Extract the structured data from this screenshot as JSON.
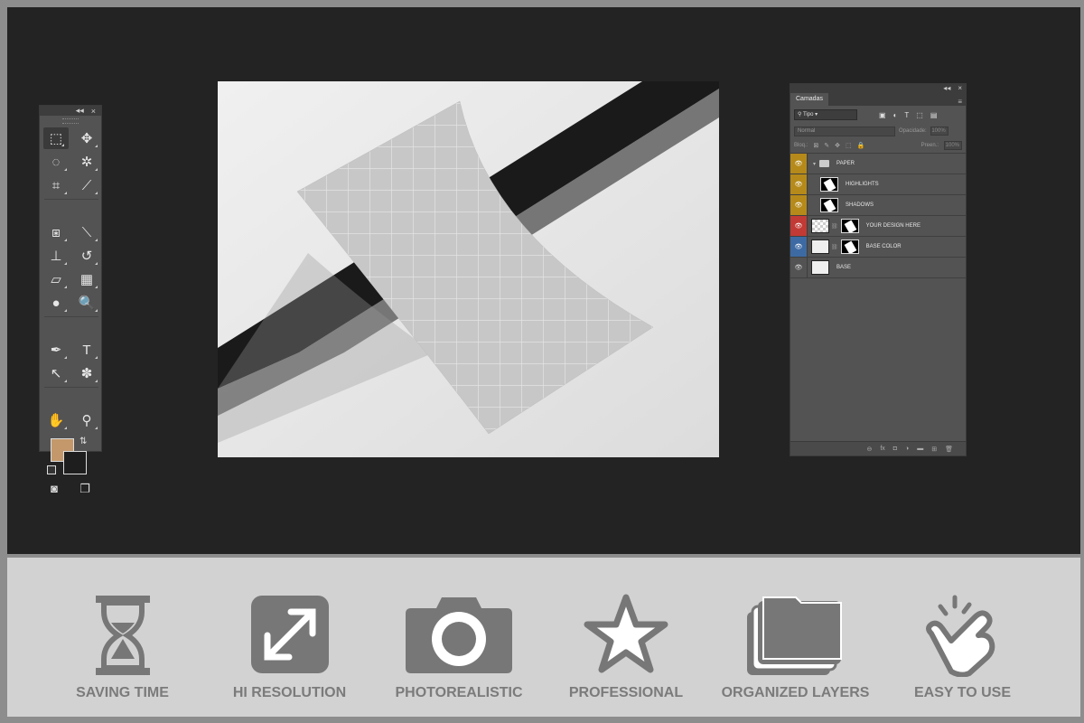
{
  "tools_panel": {
    "collapse_glyph": "◂◂",
    "close_glyph": "×",
    "foreground_color": "#c4986a",
    "background_color": "#1e1e1e",
    "tools": [
      {
        "name": "marquee-icon",
        "glyph": "⬚"
      },
      {
        "name": "move-icon",
        "glyph": "✥"
      },
      {
        "name": "lasso-icon",
        "glyph": "◌"
      },
      {
        "name": "magic-wand-icon",
        "glyph": "✲"
      },
      {
        "name": "crop-icon",
        "glyph": "⌗"
      },
      {
        "name": "eyedropper-icon",
        "glyph": "⟋"
      },
      {
        "name": "healing-brush-icon",
        "glyph": "⧆"
      },
      {
        "name": "brush-icon",
        "glyph": "⟍"
      },
      {
        "name": "stamp-icon",
        "glyph": "⊥"
      },
      {
        "name": "history-brush-icon",
        "glyph": "↺"
      },
      {
        "name": "eraser-icon",
        "glyph": "▱"
      },
      {
        "name": "gradient-icon",
        "glyph": "▦"
      },
      {
        "name": "blur-icon",
        "glyph": "●"
      },
      {
        "name": "dodge-icon",
        "glyph": "🔍"
      },
      {
        "name": "pen-icon",
        "glyph": "✒"
      },
      {
        "name": "type-icon",
        "glyph": "T"
      },
      {
        "name": "path-selection-icon",
        "glyph": "↖"
      },
      {
        "name": "shape-icon",
        "glyph": "✽"
      },
      {
        "name": "hand-icon",
        "glyph": "✋"
      },
      {
        "name": "zoom-icon",
        "glyph": "⚲"
      }
    ]
  },
  "layers_panel": {
    "tab": "Camadas",
    "filter_value": "Tipo",
    "blend_mode": "Normal",
    "opacity_label": "Opacidade:",
    "opacity_value": "100%",
    "lock_label": "Bloq.:",
    "fill_label": "Preen.:",
    "fill_value": "100%",
    "layers": [
      {
        "name": "PAPER",
        "color": "yellow",
        "type": "folder"
      },
      {
        "name": "HIGHLIGHTS",
        "color": "yellow",
        "type": "layer"
      },
      {
        "name": "SHADOWS",
        "color": "yellow",
        "type": "layer"
      },
      {
        "name": "YOUR DESIGN HERE",
        "color": "red",
        "type": "smart"
      },
      {
        "name": "BASE COLOR",
        "color": "blue",
        "type": "fill"
      },
      {
        "name": "BASE",
        "color": "none",
        "type": "image"
      }
    ]
  },
  "features": [
    {
      "label": "SAVING TIME",
      "icon": "hourglass-icon"
    },
    {
      "label": "HI RESOLUTION",
      "icon": "expand-arrows-icon"
    },
    {
      "label": "PHOTOREALISTIC",
      "icon": "camera-icon"
    },
    {
      "label": "PROFESSIONAL",
      "icon": "star-icon"
    },
    {
      "label": "ORGANIZED LAYERS",
      "icon": "layers-folder-icon"
    },
    {
      "label": "EASY TO USE",
      "icon": "pointing-hand-icon"
    }
  ]
}
